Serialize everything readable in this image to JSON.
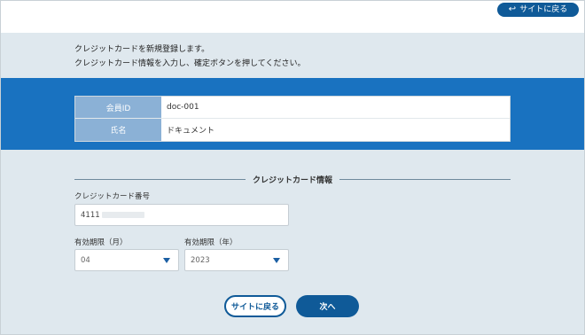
{
  "header": {
    "back_to_site_label": "サイトに戻る",
    "back_icon": "return-arrow-icon"
  },
  "intro": {
    "line1": "クレジットカードを新規登録します。",
    "line2": "クレジットカード情報を入力し、確定ボタンを押してください。"
  },
  "member": {
    "rows": [
      {
        "label": "会員ID",
        "value": "doc-001"
      },
      {
        "label": "氏名",
        "value": "ドキュメント"
      }
    ]
  },
  "card_section": {
    "title": "クレジットカード情報",
    "card_number_label": "クレジットカード番号",
    "card_number_value": "4111",
    "expiry_month_label": "有効期限（月）",
    "expiry_month_value": "04",
    "expiry_year_label": "有効期限（年）",
    "expiry_year_value": "2023"
  },
  "actions": {
    "back_label": "サイトに戻る",
    "next_label": "次へ"
  },
  "colors": {
    "primary": "#0f5a98",
    "band": "#1972c0",
    "label_cell": "#8bb1d6",
    "background": "#dfe8ee"
  }
}
